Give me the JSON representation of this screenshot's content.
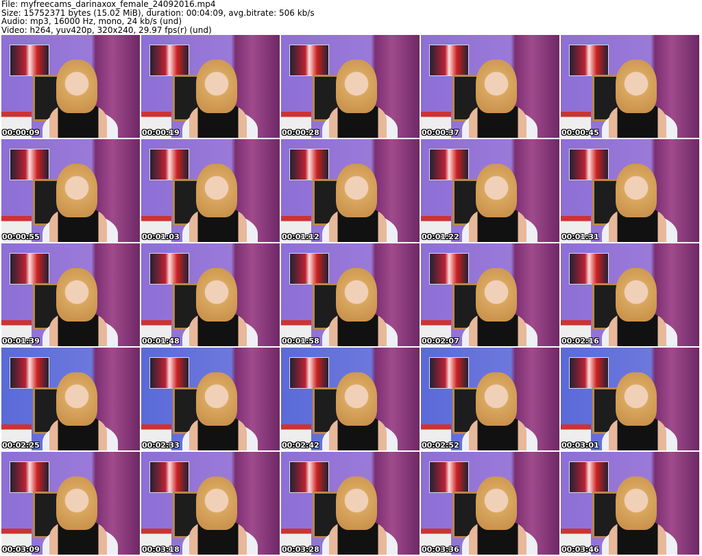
{
  "header": {
    "file": "File: myfreecams_darinaxox_female_24092016.mp4",
    "size": "Size: 15752371 bytes (15.02 MiB), duration: 00:04:09, avg.bitrate: 506 kb/s",
    "audio": "Audio: mp3, 16000 Hz, mono, 24 kb/s (und)",
    "video": "Video: h264, yuv420p, 320x240, 29.97 fps(r) (und)"
  },
  "thumbnails": [
    "00:00:09",
    "00:00:19",
    "00:00:28",
    "00:00:37",
    "00:00:45",
    "00:00:55",
    "00:01:03",
    "00:01:12",
    "00:01:22",
    "00:01:31",
    "00:01:39",
    "00:01:48",
    "00:01:58",
    "00:02:07",
    "00:02:16",
    "00:02:25",
    "00:02:33",
    "00:02:42",
    "00:02:52",
    "00:03:01",
    "00:03:09",
    "00:03:18",
    "00:03:28",
    "00:03:36",
    "00:03:46"
  ]
}
